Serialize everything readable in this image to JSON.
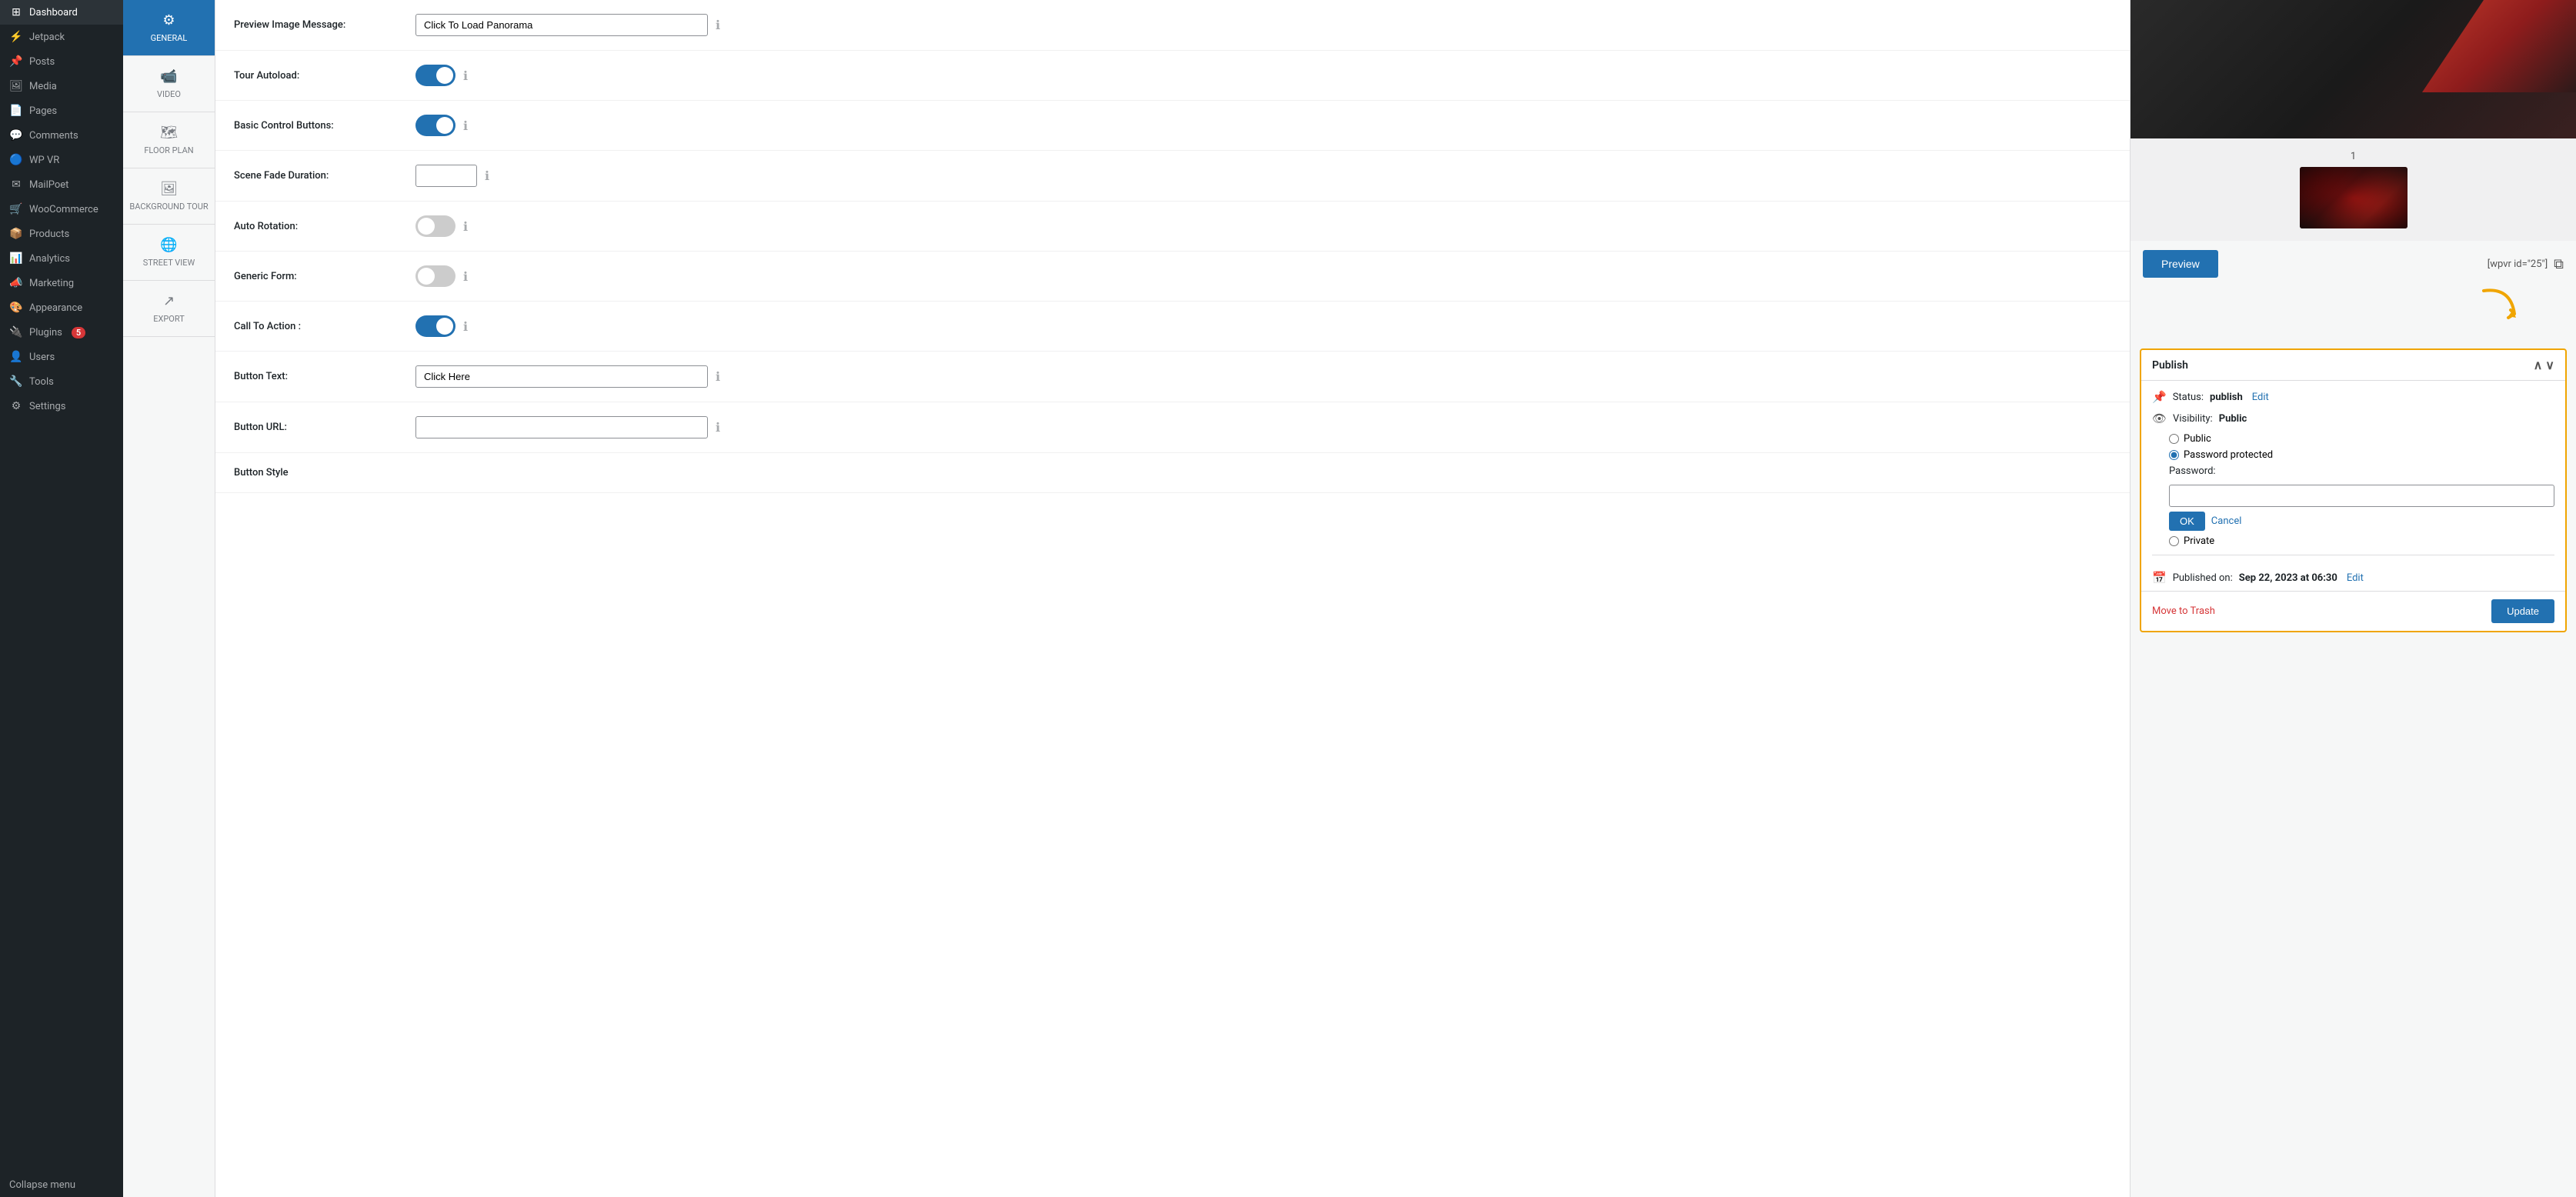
{
  "sidebar": {
    "items": [
      {
        "id": "dashboard",
        "label": "Dashboard",
        "icon": "⊞"
      },
      {
        "id": "jetpack",
        "label": "Jetpack",
        "icon": "⚡"
      },
      {
        "id": "posts",
        "label": "Posts",
        "icon": "📌"
      },
      {
        "id": "media",
        "label": "Media",
        "icon": "🖼"
      },
      {
        "id": "pages",
        "label": "Pages",
        "icon": "📄"
      },
      {
        "id": "comments",
        "label": "Comments",
        "icon": "💬"
      },
      {
        "id": "wp-vr",
        "label": "WP VR",
        "icon": "🔵"
      },
      {
        "id": "mailpoet",
        "label": "MailPoet",
        "icon": "✉"
      },
      {
        "id": "woocommerce",
        "label": "WooCommerce",
        "icon": "🛒"
      },
      {
        "id": "products",
        "label": "Products",
        "icon": "📦"
      },
      {
        "id": "analytics",
        "label": "Analytics",
        "icon": "📊"
      },
      {
        "id": "marketing",
        "label": "Marketing",
        "icon": "📣"
      },
      {
        "id": "appearance",
        "label": "Appearance",
        "icon": "🎨"
      },
      {
        "id": "plugins",
        "label": "Plugins",
        "icon": "🔌",
        "badge": "5"
      },
      {
        "id": "users",
        "label": "Users",
        "icon": "👤"
      },
      {
        "id": "tools",
        "label": "Tools",
        "icon": "🔧"
      },
      {
        "id": "settings",
        "label": "Settings",
        "icon": "⚙"
      }
    ],
    "collapse_label": "Collapse menu"
  },
  "tabs": [
    {
      "id": "general",
      "label": "GENERAL",
      "icon": "⚙",
      "active": true
    },
    {
      "id": "video",
      "label": "VIDEO",
      "icon": "🎥"
    },
    {
      "id": "floor-plan",
      "label": "FLOOR PLAN",
      "icon": "🗺"
    },
    {
      "id": "background-tour",
      "label": "BACKGROUND TOUR",
      "icon": "🖼"
    },
    {
      "id": "street-view",
      "label": "STREET VIEW",
      "icon": "🌐"
    },
    {
      "id": "export",
      "label": "EXPORT",
      "icon": "↗"
    }
  ],
  "settings": {
    "preview_image_message_label": "Preview Image Message:",
    "preview_image_message_value": "Click To Load Panorama",
    "tour_autoload_label": "Tour Autoload:",
    "tour_autoload_on": true,
    "basic_control_buttons_label": "Basic Control Buttons:",
    "basic_control_buttons_on": true,
    "scene_fade_duration_label": "Scene Fade Duration:",
    "scene_fade_duration_value": "",
    "auto_rotation_label": "Auto Rotation:",
    "auto_rotation_on": false,
    "generic_form_label": "Generic Form:",
    "generic_form_on": false,
    "call_to_action_label": "Call To Action :",
    "call_to_action_on": true,
    "button_text_label": "Button Text:",
    "button_text_value": "Click Here",
    "button_url_label": "Button URL:",
    "button_url_value": "",
    "button_style_label": "Button Style"
  },
  "right_panel": {
    "scene_number": "1",
    "preview_button_label": "Preview",
    "shortcode_text": "[wpvr id=\"25\"]",
    "publish_header": "Publish",
    "status_label": "Status:",
    "status_value": "publish",
    "status_edit": "Edit",
    "visibility_label": "Visibility:",
    "visibility_value": "Public",
    "radio_public": "Public",
    "radio_password": "Password protected",
    "radio_private": "Private",
    "password_label": "Password:",
    "password_value": "",
    "ok_label": "OK",
    "cancel_label": "Cancel",
    "published_on_label": "Published on:",
    "published_on_value": "Sep 22, 2023 at 06:30",
    "published_on_edit": "Edit",
    "move_to_trash_label": "Move to Trash",
    "update_label": "Update"
  }
}
